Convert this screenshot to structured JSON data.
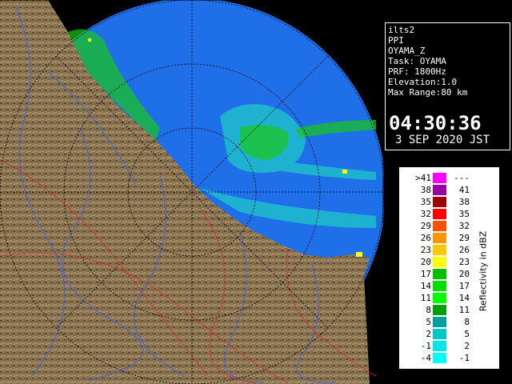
{
  "info": {
    "lines": [
      "ilts2",
      "PPI",
      "OYAMA_Z",
      "Task: OYAMA",
      "PRF: 1800Hz",
      "Elevation:1.0",
      "Max Range:80 km"
    ],
    "time": "04:30:36",
    "date": "3 SEP 2020 JST"
  },
  "legend": {
    "unit_label": "Reflectivity in dBZ",
    "rows": [
      {
        "low": ">41",
        "high": "---",
        "color": "#ff00ff"
      },
      {
        "low": "38",
        "high": "41",
        "color": "#9a00a0"
      },
      {
        "low": "35",
        "high": "38",
        "color": "#a00000"
      },
      {
        "low": "32",
        "high": "35",
        "color": "#ff0000"
      },
      {
        "low": "29",
        "high": "32",
        "color": "#ff5000"
      },
      {
        "low": "26",
        "high": "29",
        "color": "#ff9600"
      },
      {
        "low": "23",
        "high": "26",
        "color": "#ffc800"
      },
      {
        "low": "20",
        "high": "23",
        "color": "#ffff00"
      },
      {
        "low": "17",
        "high": "20",
        "color": "#00c000"
      },
      {
        "low": "14",
        "high": "17",
        "color": "#00e000"
      },
      {
        "low": "11",
        "high": "14",
        "color": "#00ff00"
      },
      {
        "low": "8",
        "high": "11",
        "color": "#00a000"
      },
      {
        "low": "5",
        "high": "8",
        "color": "#00a0a0"
      },
      {
        "low": "2",
        "high": "5",
        "color": "#00c8c8"
      },
      {
        "low": "-1",
        "high": "2",
        "color": "#00e6e6"
      },
      {
        "low": "-4",
        "high": "-1",
        "color": "#00ffff"
      }
    ]
  },
  "colors": {
    "sea": "#1e6fe8",
    "land": "#8a7550",
    "land_dark": "#5c4a30",
    "echo_cyan": "#20c8c8",
    "echo_green": "#18c818",
    "river": "#4a60d0",
    "road": "#d03030"
  }
}
